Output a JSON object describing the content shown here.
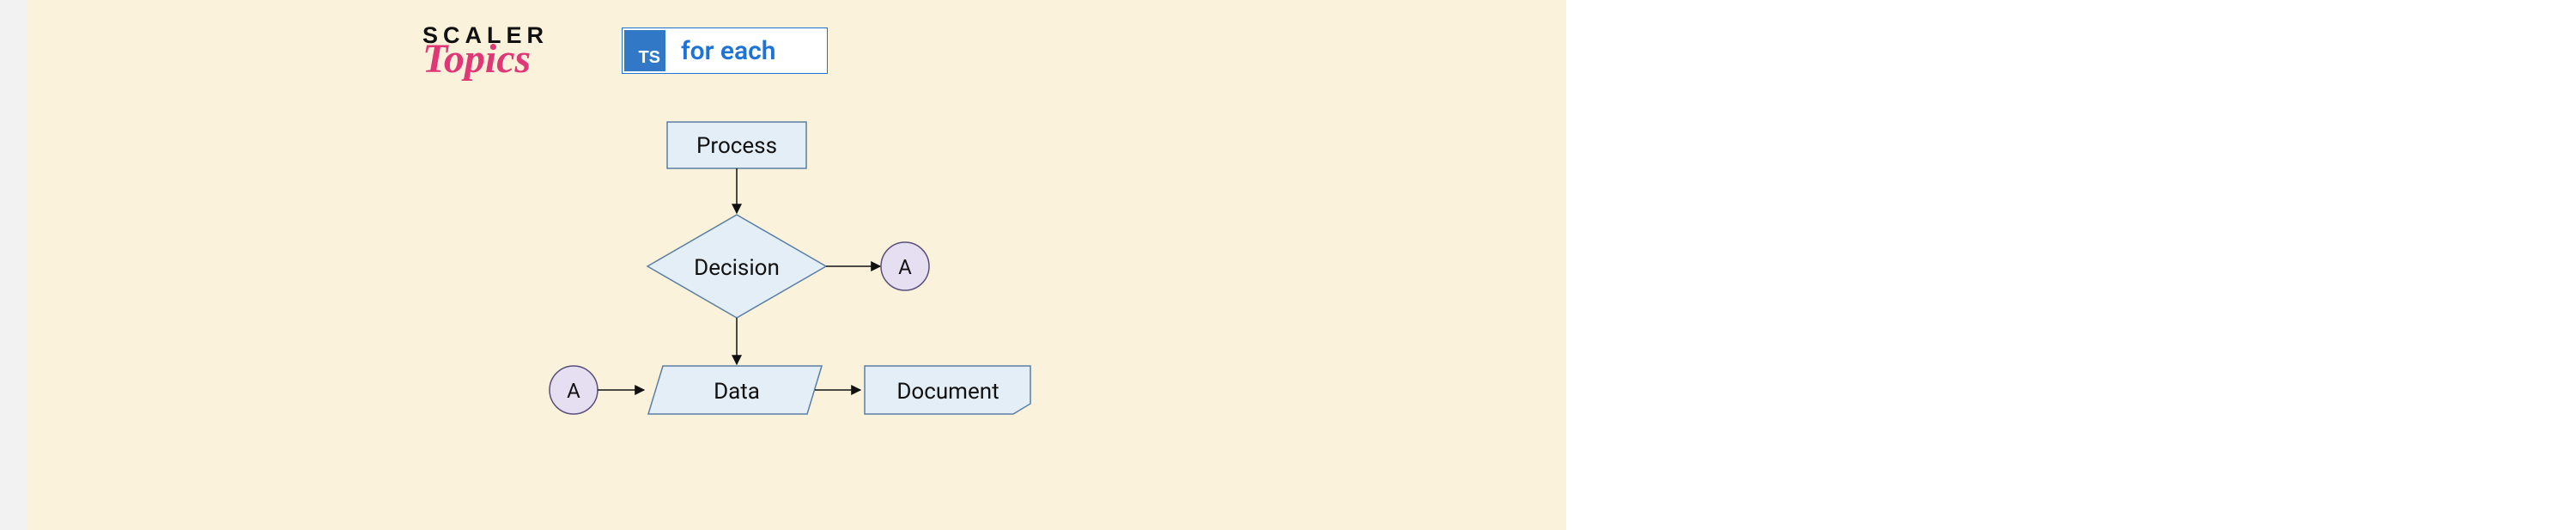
{
  "logo": {
    "line1": "SCALER",
    "line2": "Topics"
  },
  "header": {
    "badge_text": "TS",
    "title": "for each"
  },
  "flowchart": {
    "nodes": {
      "process": {
        "type": "process",
        "label": "Process"
      },
      "decision": {
        "type": "decision",
        "label": "Decision"
      },
      "connector_right": {
        "type": "connector",
        "label": "A"
      },
      "connector_left": {
        "type": "connector",
        "label": "A"
      },
      "data": {
        "type": "data",
        "label": "Data"
      },
      "document": {
        "type": "document",
        "label": "Document"
      }
    },
    "edges": [
      {
        "from": "process",
        "to": "decision"
      },
      {
        "from": "decision",
        "to": "connector_right"
      },
      {
        "from": "decision",
        "to": "data"
      },
      {
        "from": "connector_left",
        "to": "data"
      },
      {
        "from": "data",
        "to": "document"
      }
    ]
  },
  "colors": {
    "background": "#fbf2dc",
    "node_fill": "#e4eef7",
    "node_stroke": "#5a7fa3",
    "connector_fill": "#e6dff1",
    "connector_stroke": "#5a4e7a",
    "ts_blue": "#3178c6",
    "accent_pink": "#e03876"
  }
}
